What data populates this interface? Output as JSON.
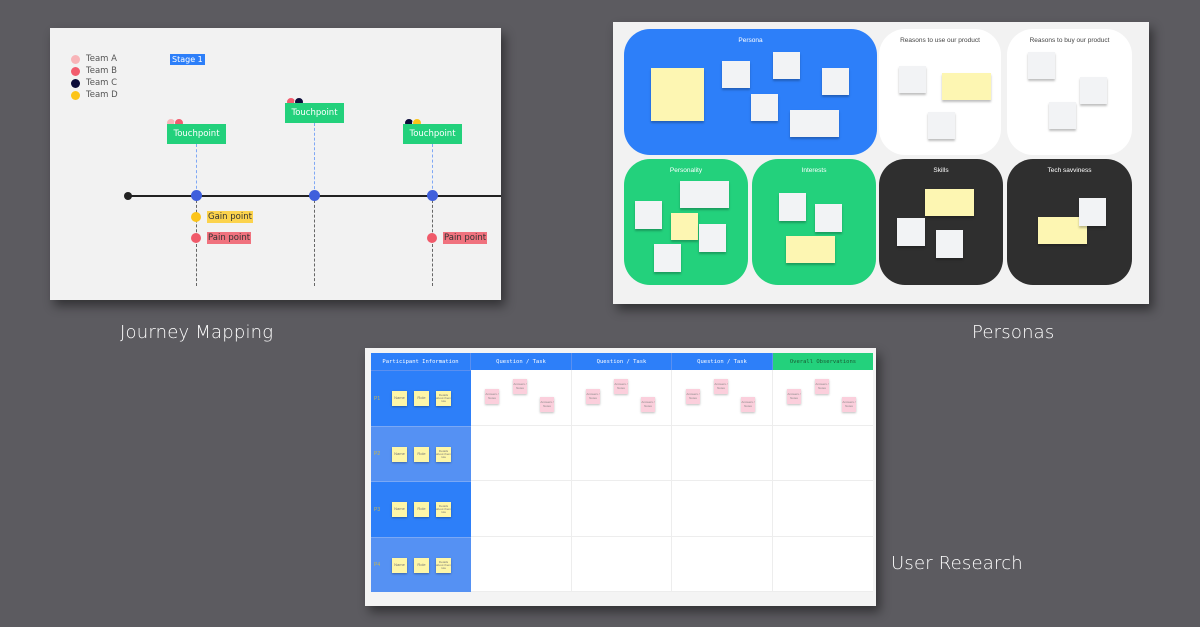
{
  "colors": {
    "background": "#5c5b60",
    "blue": "#2d7ff9",
    "light_blue": "#5591f3",
    "green": "#23d17c",
    "dark": "#2f2f2f",
    "sticky_yellow": "#fdf6b2",
    "sticky_pink": "#fbcfdc",
    "pain_red": "#f05a6a",
    "gain_yellow": "#fcc419"
  },
  "journey": {
    "caption": "Journey Mapping",
    "legend": [
      {
        "label": "Team A",
        "color": "#f8b4b8"
      },
      {
        "label": "Team B",
        "color": "#f25c6e"
      },
      {
        "label": "Team C",
        "color": "#0c0c3a"
      },
      {
        "label": "Team D",
        "color": "#fcc419"
      }
    ],
    "stage_label": "Stage 1",
    "touchpoints": [
      {
        "label": "Touchpoint",
        "teams": [
          "#f8b4b8",
          "#f25c6e"
        ]
      },
      {
        "label": "Touchpoint",
        "teams": [
          "#f25c6e",
          "#0c0c3a"
        ]
      },
      {
        "label": "Touchpoint",
        "teams": [
          "#0c0c3a",
          "#fcc419"
        ]
      }
    ],
    "gain_point": "Gain point",
    "pain_point_1": "Pain point",
    "pain_point_2": "Pain point"
  },
  "personas": {
    "caption": "Personas",
    "panels": {
      "persona": "Persona",
      "reasons_use": "Reasons to use our product",
      "reasons_buy": "Reasons to buy our product",
      "personality": "Personality",
      "interests": "Interests",
      "skills": "Skills",
      "tech": "Tech savviness"
    }
  },
  "research": {
    "caption": "User Research",
    "headers": [
      "Participant Information",
      "Question / Task",
      "Question / Task",
      "Question / Task",
      "Overall Observations"
    ],
    "participants": [
      "P1",
      "P2",
      "P3",
      "P4"
    ],
    "info_stickies": [
      "Name",
      "Role",
      "Details about them role"
    ],
    "answer_stickies": [
      "Answers / Notes",
      "Answers / Notes",
      "Answers / Notes"
    ]
  }
}
